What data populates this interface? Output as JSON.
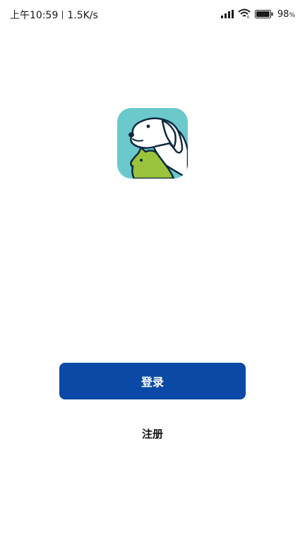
{
  "status_bar": {
    "time": "上午10:59",
    "network_speed": "1.5K/s",
    "battery_percent": "98",
    "battery_unit": "%",
    "battery_level": 0.98,
    "icons": [
      "signal-icon",
      "wifi-icon",
      "battery-icon"
    ]
  },
  "logo": {
    "icon": "pet-dog-cat-logo",
    "colors": {
      "background": "#6bc9cc",
      "dog": "#ffffff",
      "cat": "#9bc43c",
      "outline": "#0e2a3f"
    }
  },
  "actions": {
    "login_label": "登录",
    "register_label": "注册"
  },
  "colors": {
    "primary": "#0a4aa6"
  }
}
